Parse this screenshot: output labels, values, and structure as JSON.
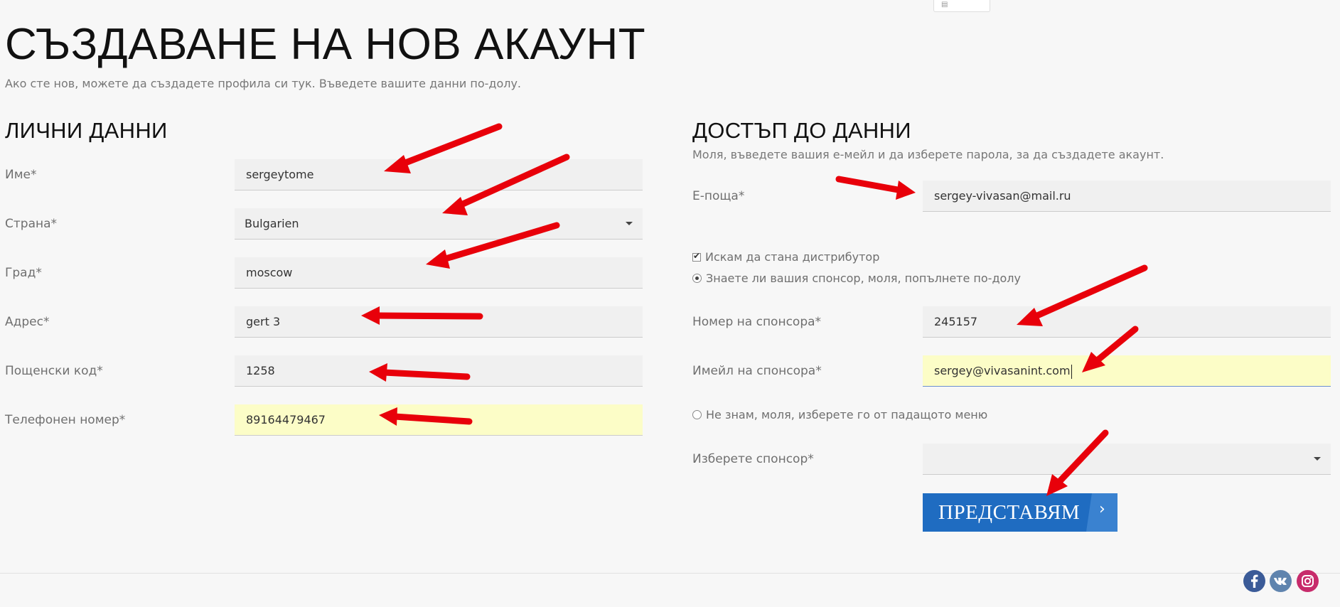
{
  "page": {
    "title": "СЪЗДАВАНЕ НА НОВ АКАУНТ",
    "intro": "Ако сте нов, можете да създадете профила си тук. Въведете вашите данни по-долу."
  },
  "personal": {
    "title": "ЛИЧНИ ДАННИ",
    "fields": [
      {
        "label": "Име*",
        "value": "sergeytome"
      },
      {
        "label": "Страна*",
        "value": "Bulgarien"
      },
      {
        "label": "Град*",
        "value": "moscow"
      },
      {
        "label": "Адрес*",
        "value": "gert 3"
      },
      {
        "label": "Пощенски код*",
        "value": "1258"
      },
      {
        "label": "Телефонен номер*",
        "value": "89164479467"
      }
    ]
  },
  "access": {
    "title": "ДОСТЪП ДО ДАННИ",
    "subtitle": "Моля, въведете вашия е-мейл и да изберете парола, за да създадете акаунт.",
    "email_label": "Е-поща*",
    "email_value": "sergey-vivasan@mail.ru",
    "distributor_label": "Искам да стана дистрибутор",
    "know_sponsor_label": "Знаете ли вашия спонсор, моля, попълнете по-долу",
    "sponsor_number_label": "Номер на спонсора*",
    "sponsor_number_value": "245157",
    "sponsor_email_label": "Имейл на спонсора*",
    "sponsor_email_value": "sergey@vivasanint.com",
    "dont_know_label": "Не знам, моля, изберете го от падащото меню",
    "choose_sponsor_label": "Изберете спонсор*",
    "choose_sponsor_value": "",
    "submit_label": "ПРЕДСТАВЯМ",
    "submit_chevron": "›"
  },
  "icons": {
    "checkbox_tick": "✔",
    "social": [
      "facebook-icon",
      "vk-icon",
      "instagram-icon"
    ]
  },
  "colors": {
    "accent": "#1f6cc1",
    "autofill": "#fcfdc7",
    "annotation_arrow": "#e8000a",
    "facebook": "#3b5b98",
    "vk": "#5f84ae",
    "instagram": "#c72b6b"
  }
}
